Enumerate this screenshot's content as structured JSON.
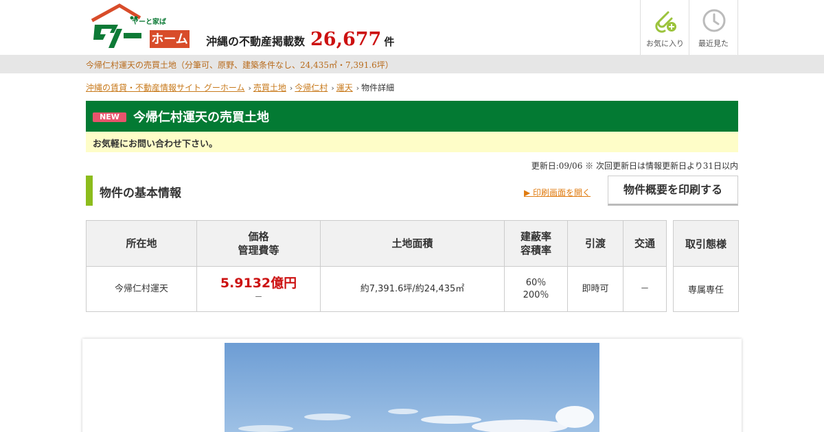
{
  "header": {
    "logo_text": "グーホーム",
    "logo_tagline": "ヤーと家ば",
    "count_label": "沖縄の不動産掲載数",
    "count_value": "26,677",
    "count_unit": "件",
    "favorites_label": "お気に入り",
    "recent_label": "最近見た",
    "favorites_icon": "paperclip-plus-icon",
    "recent_icon": "clock-icon",
    "accent_color": "#037a33"
  },
  "subtitle": "今帰仁村運天の売買土地（分筆可、原野、建築条件なし、24,435㎡・7,391.6坪）",
  "breadcrumb": {
    "items": [
      "沖縄の賃貸・不動産情報サイト グーホーム",
      "売買土地",
      "今帰仁村",
      "運天"
    ],
    "current": "物件詳細"
  },
  "title": {
    "badge": "NEW",
    "text": "今帰仁村運天の売買土地",
    "notice": "お気軽にお問い合わせ下さい。"
  },
  "updated": "更新日:09/06 ※ 次回更新日は情報更新日より31日以内",
  "section": {
    "heading": "物件の基本情報",
    "print_link": "▶ 印刷画面を開く",
    "print_button": "物件概要を印刷する"
  },
  "table": {
    "headers": {
      "location": "所在地",
      "price_line1": "価格",
      "price_line2": "管理費等",
      "area": "土地面積",
      "ratio_line1": "建蔽率",
      "ratio_line2": "容積率",
      "handover": "引渡",
      "transport": "交通",
      "trade": "取引態様"
    },
    "row": {
      "location": "今帰仁村運天",
      "price": "5.9132億円",
      "management_fee": "－",
      "area": "約7,391.6坪/約24,435㎡",
      "coverage": "60％",
      "floor_area": "200％",
      "handover": "即時可",
      "transport": "－",
      "trade": "専属専任"
    }
  }
}
